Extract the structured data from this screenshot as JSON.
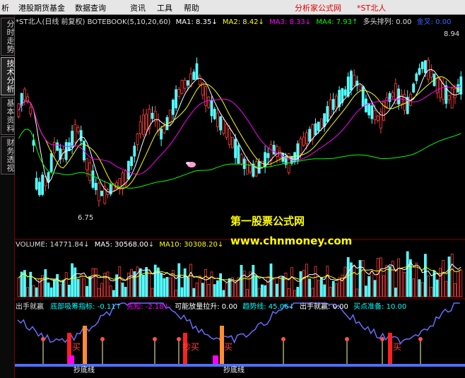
{
  "menu": {
    "items": [
      "析",
      "港股期货基金",
      "数据查询",
      "资讯",
      "工具",
      "帮助"
    ],
    "right_link": "分析家公式网",
    "right_stock": "*ST北人"
  },
  "sidebar": {
    "tabs": [
      "分时走势",
      "技术分析",
      "基本资料",
      "财务透视"
    ],
    "active_tab": "技术分析"
  },
  "price_panel": {
    "title": "*ST北人(日线 前复权) BOTEBOOK(5,10,20,60)",
    "ma1": {
      "label": "MA1:",
      "value": "8.35",
      "color": "#ffffff"
    },
    "ma2": {
      "label": "MA2:",
      "value": "8.42",
      "color": "#ffff00"
    },
    "ma3": {
      "label": "MA3:",
      "value": "8.33",
      "color": "#ff00ff"
    },
    "ma4": {
      "label": "MA4:",
      "value": "7.93",
      "color": "#00ff00"
    },
    "trend": {
      "label": "多头排列:",
      "value": "0.00"
    },
    "flag": {
      "label": "金叉:",
      "value": "0.00"
    },
    "high_label": "8.94",
    "low_label": "6.75"
  },
  "volume_panel": {
    "volume": {
      "label": "VOLUME:",
      "value": "14771.84"
    },
    "ma5": {
      "label": "MA5:",
      "value": "30568.00"
    },
    "ma10": {
      "label": "MA10:",
      "value": "30308.20"
    }
  },
  "indicator_panel": {
    "name": "出手就赢",
    "items": [
      {
        "label": "底部吸筹指标:",
        "value": "-0.11",
        "color": "#00ffff"
      },
      {
        "label": "先知:",
        "value": "-2.18",
        "color": "#ff00ff"
      },
      {
        "label": "可能放量拉升:",
        "value": "0.00",
        "color": "#ffffff"
      },
      {
        "label": "趋势线:",
        "value": "45.06",
        "color": "#00ffff"
      },
      {
        "label": "出手就赢:",
        "value": "0.00",
        "color": "#ffffff"
      },
      {
        "label": "买点准备:",
        "value": "10.00",
        "color": "#00ffff"
      }
    ],
    "signal_labels": [
      "买",
      "抄买",
      "买",
      "买"
    ],
    "bottom_labels": [
      "抄底线",
      "抄底线"
    ]
  },
  "watermark": {
    "line1": "第一股票公式网",
    "line2": "www.chnmoney.com"
  },
  "colors": {
    "up": "#ff3c3c",
    "down": "#54ffff",
    "bg": "#000000"
  }
}
